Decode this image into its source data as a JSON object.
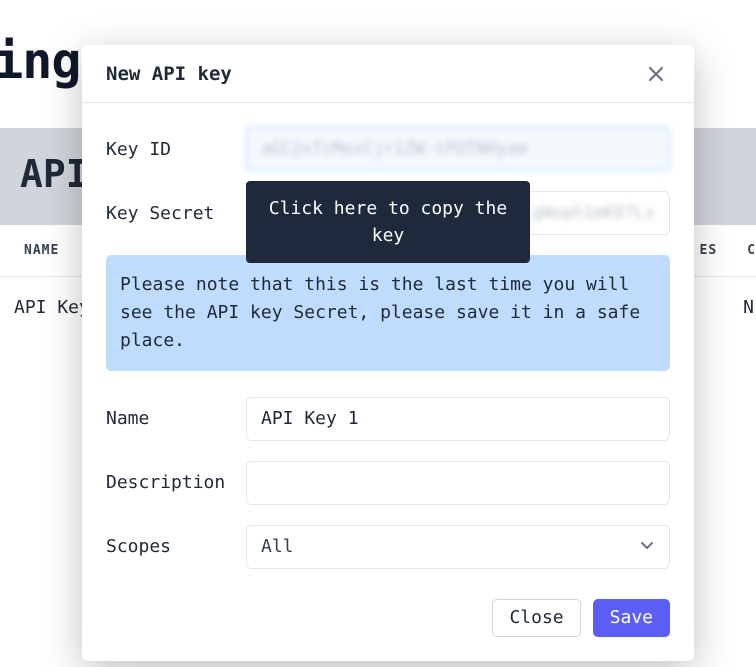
{
  "background": {
    "page_heading_fragment": "ttings",
    "section_heading_fragment": "API",
    "table": {
      "col_name": "NAME",
      "col_right_fragment": "ES",
      "col_far_right_fragment": "C",
      "row0_name_fragment": "API Key",
      "row0_right_fragment": "N"
    }
  },
  "modal": {
    "title": "New API key",
    "labels": {
      "key_id": "Key ID",
      "key_secret": "Key Secret",
      "name": "Name",
      "description": "Description",
      "scopes": "Scopes"
    },
    "key_id_value": "aGC2xTcMexCjr1ZW-tPUTNHyam",
    "key_secret_value": "gWoph1mK87Lx",
    "tooltip": "Click here to copy the key",
    "notice": "Please note that this is the last time you will see the API key Secret, please save it in a safe place.",
    "name_value": "API Key 1",
    "description_value": "",
    "scopes_value": "All",
    "buttons": {
      "close": "Close",
      "save": "Save"
    }
  }
}
